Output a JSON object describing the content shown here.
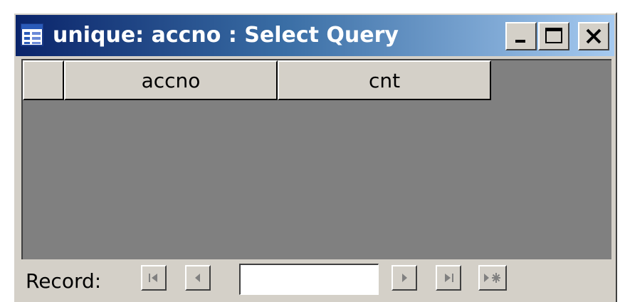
{
  "window": {
    "title": "unique: accno : Select Query",
    "icon": "query-icon",
    "controls": [
      "minimize-icon",
      "maximize-icon",
      "close-icon"
    ]
  },
  "datasheet": {
    "columns": [
      {
        "label": "accno"
      },
      {
        "label": "cnt"
      }
    ],
    "rows": []
  },
  "navigation": {
    "label": "Record:",
    "record_value": "",
    "buttons": [
      "first-record-icon",
      "previous-record-icon",
      "next-record-icon",
      "last-record-icon",
      "new-record-icon"
    ]
  },
  "colors": {
    "title_gradient_start": "#0a246a",
    "title_gradient_end": "#a6caf0",
    "face": "#d4d0c8",
    "empty_grid": "#808080"
  }
}
